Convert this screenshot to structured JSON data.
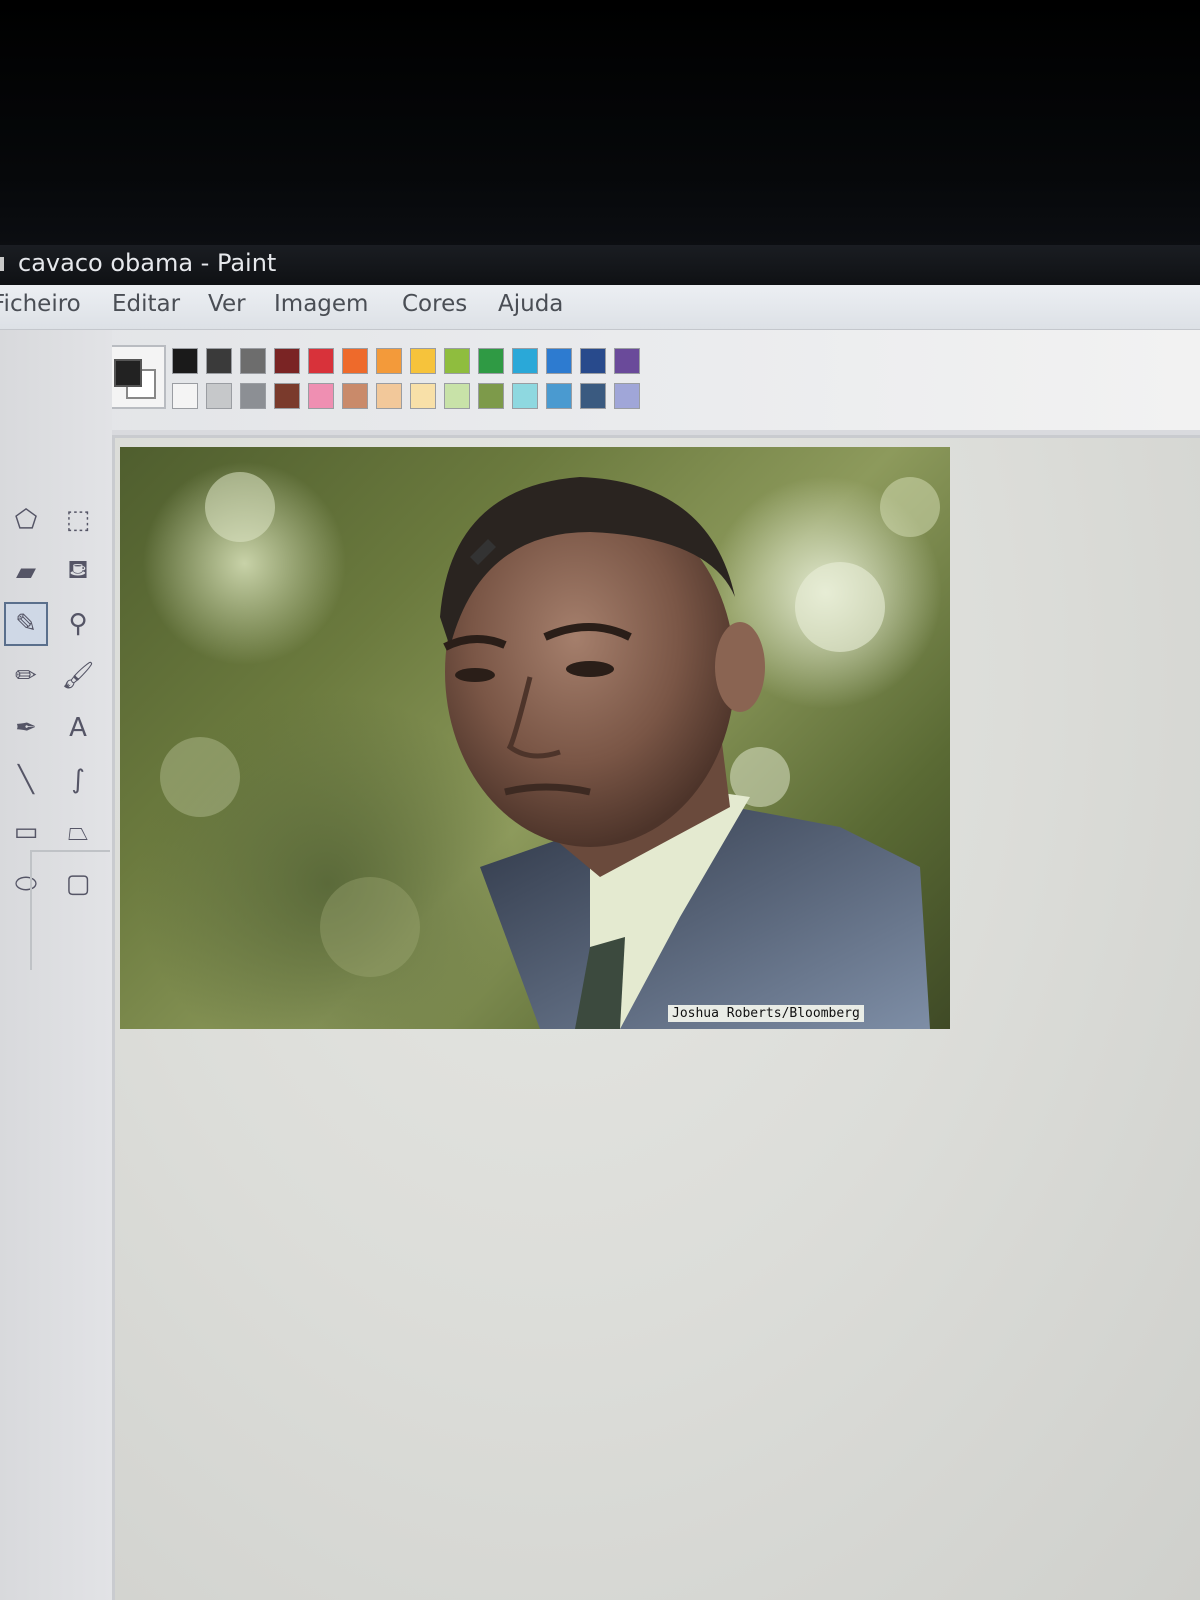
{
  "window": {
    "title": "cavaco obama - Paint"
  },
  "menu": [
    "Ficheiro",
    "Editar",
    "Ver",
    "Imagem",
    "Cores",
    "Ajuda"
  ],
  "tools": [
    {
      "name": "free-select-icon",
      "glyph": "⬠"
    },
    {
      "name": "select-icon",
      "glyph": "⬚"
    },
    {
      "name": "eraser-icon",
      "glyph": "▰"
    },
    {
      "name": "fill-bucket-icon",
      "glyph": "⛾"
    },
    {
      "name": "color-picker-icon",
      "glyph": "✎"
    },
    {
      "name": "magnifier-icon",
      "glyph": "⚲"
    },
    {
      "name": "pencil-icon",
      "glyph": "✏"
    },
    {
      "name": "brush-icon",
      "glyph": "🖌"
    },
    {
      "name": "airbrush-icon",
      "glyph": "✒"
    },
    {
      "name": "text-icon",
      "glyph": "A"
    },
    {
      "name": "line-icon",
      "glyph": "╲"
    },
    {
      "name": "curve-icon",
      "glyph": "∫"
    },
    {
      "name": "rectangle-icon",
      "glyph": "▭"
    },
    {
      "name": "polygon-icon",
      "glyph": "⏢"
    },
    {
      "name": "ellipse-icon",
      "glyph": "⬭"
    },
    {
      "name": "rounded-rectangle-icon",
      "glyph": "▢"
    }
  ],
  "selected_tool": "color-picker-icon",
  "current_colors": {
    "foreground": "#222222",
    "background": "#ffffff"
  },
  "palette_top": [
    "#1a1a1a",
    "#3a3a3a",
    "#6d6d6d",
    "#7a2424",
    "#d8323a",
    "#ee6a2b",
    "#f39a3a",
    "#f6c33b",
    "#8fbd3e",
    "#2f9a44",
    "#2aa8d8",
    "#2d7bd0",
    "#284a8c",
    "#6a4a9a"
  ],
  "palette_bottom": [
    "#f4f4f4",
    "#c6c8ca",
    "#8c8f94",
    "#7a3a2c",
    "#ef8fb2",
    "#c98a6a",
    "#f2c89a",
    "#f8e0a8",
    "#c8e2a8",
    "#7d9a4a",
    "#8ed8e0",
    "#4a9ad0",
    "#3a5a80",
    "#a0a6d8"
  ],
  "canvas": {
    "credit": "Joshua Roberts/Bloomberg"
  }
}
